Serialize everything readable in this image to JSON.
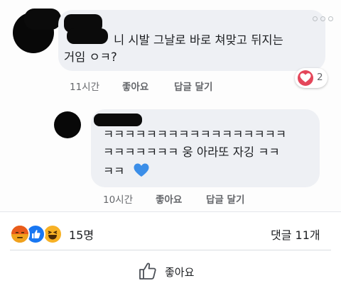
{
  "comments": [
    {
      "text_line1": "니 시발 그날로 바로 쳐맞고 뒤지는",
      "text_line2": "거임 ㅇㅋ?",
      "time": "11시간",
      "like_label": "좋아요",
      "reply_label": "답글 달기",
      "reaction_count": "2",
      "reaction_type": "love"
    },
    {
      "text_line1": "ㅋㅋㅋㅋㅋㅋㅋㅋㅋㅋㅋㅋㅋㅋㅋㅋㅋ",
      "text_line2": "ㅋㅋㅋㅋㅋㅋㅋ 웅 아라또 자깅 ㅋㅋ",
      "text_line3": "ㅋㅋ",
      "emoji": "💙",
      "time": "10시간",
      "like_label": "좋아요",
      "reply_label": "답글 달기"
    }
  ],
  "post_stats": {
    "reactions_count": "15명",
    "reaction_types": [
      "angry",
      "like",
      "haha"
    ],
    "comments_count": "댓글 11개"
  },
  "actions": {
    "like_label": "좋아요"
  },
  "colors": {
    "bubble": "#eef0f4",
    "meta_text": "#65676b",
    "love": "#e4465a",
    "like": "#1877f2",
    "angry": "#e9710f",
    "haha": "#f7b125"
  }
}
